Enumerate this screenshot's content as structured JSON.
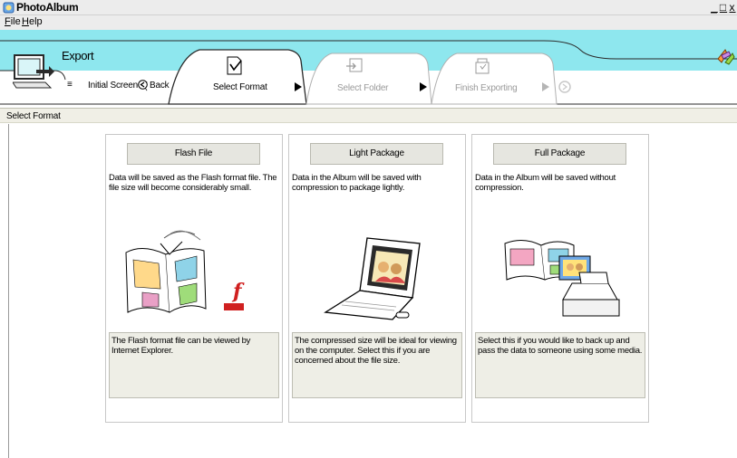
{
  "app": {
    "title": "PhotoAlbum",
    "window_buttons": [
      "_",
      "4",
      "x"
    ]
  },
  "menu": {
    "file": "ile",
    "file_key": "F",
    "help": "elp",
    "help_key": "H"
  },
  "wizard": {
    "title": "Export",
    "initial_screen": "Initial Screen",
    "back": "Back",
    "steps": [
      {
        "label": "Select Format",
        "state": "active"
      },
      {
        "label": "Select Folder",
        "state": "inactive"
      },
      {
        "label": "Finish Exporting",
        "state": "inactive"
      }
    ]
  },
  "section": {
    "label": "Select Format"
  },
  "formats": [
    {
      "button": "Flash File",
      "description": "Data will be saved as the Flash format file. The file size will become considerably small.",
      "note": "The Flash format file can be viewed by Internet Explorer."
    },
    {
      "button": "Light Package",
      "description": "Data in the Album will be saved with compression to package lightly.",
      "note": "The compressed size will be ideal for viewing on the computer.  Select this if you are concerned about the file size."
    },
    {
      "button": "Full Package",
      "description": "Data in the Album will be saved without compression.",
      "note": "Select this if you would like to back up and pass the data to someone using some media."
    }
  ],
  "colors": {
    "accent_cyan": "#8ee7ee",
    "tab_border": "#2a2a2a",
    "inactive": "#9a9a9a",
    "menu_bg": "#ececec"
  }
}
